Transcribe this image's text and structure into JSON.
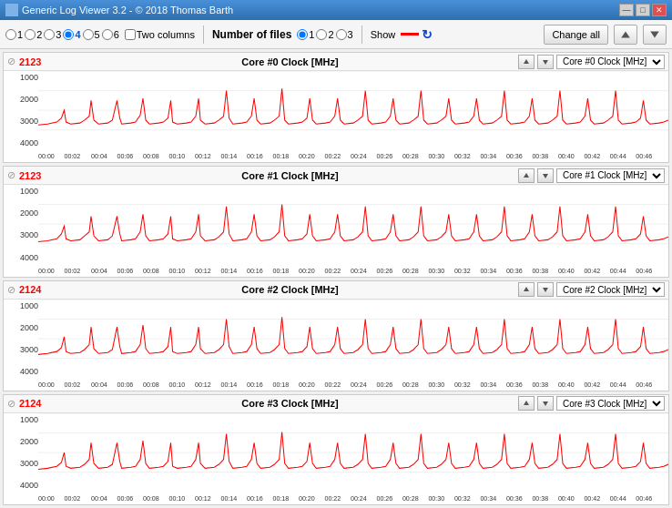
{
  "window": {
    "title": "Generic Log Viewer 3.2 - © 2018 Thomas Barth"
  },
  "toolbar": {
    "radio_labels": [
      "1",
      "2",
      "3",
      "4",
      "5",
      "6"
    ],
    "checked_radio": "4",
    "two_columns_label": "Two columns",
    "two_columns_checked": false,
    "number_of_files_label": "Number of files",
    "file_radios": [
      "1",
      "2",
      "3"
    ],
    "file_checked": "1",
    "show_label": "Show",
    "change_all_label": "Change all"
  },
  "charts": [
    {
      "id": "chart0",
      "phi": "⊘",
      "value": "2123",
      "title": "Core #0 Clock [MHz]",
      "dropdown": "Core #0 Clock [MHz]",
      "y_labels": [
        "4000",
        "3000",
        "2000",
        "1000"
      ],
      "x_labels": [
        "00:00",
        "00:02",
        "00:04",
        "00:06",
        "00:08",
        "00:10",
        "00:12",
        "00:14",
        "00:16",
        "00:18",
        "00:20",
        "00:22",
        "00:24",
        "00:26",
        "00:28",
        "00:30",
        "00:32",
        "00:34",
        "00:36",
        "00:38",
        "00:40",
        "00:42",
        "00:44",
        "00:46"
      ]
    },
    {
      "id": "chart1",
      "phi": "⊘",
      "value": "2123",
      "title": "Core #1 Clock [MHz]",
      "dropdown": "Core #1 Clock [MHz]",
      "y_labels": [
        "4000",
        "3000",
        "2000",
        "1000"
      ],
      "x_labels": [
        "00:00",
        "00:02",
        "00:04",
        "00:06",
        "00:08",
        "00:10",
        "00:12",
        "00:14",
        "00:16",
        "00:18",
        "00:20",
        "00:22",
        "00:24",
        "00:26",
        "00:28",
        "00:30",
        "00:32",
        "00:34",
        "00:36",
        "00:38",
        "00:40",
        "00:42",
        "00:44",
        "00:46"
      ]
    },
    {
      "id": "chart2",
      "phi": "⊘",
      "value": "2124",
      "title": "Core #2 Clock [MHz]",
      "dropdown": "Core #2 Clock [MHz]",
      "y_labels": [
        "4000",
        "3000",
        "2000",
        "1000"
      ],
      "x_labels": [
        "00:00",
        "00:02",
        "00:04",
        "00:06",
        "00:08",
        "00:10",
        "00:12",
        "00:14",
        "00:16",
        "00:18",
        "00:20",
        "00:22",
        "00:24",
        "00:26",
        "00:28",
        "00:30",
        "00:32",
        "00:34",
        "00:36",
        "00:38",
        "00:40",
        "00:42",
        "00:44",
        "00:46"
      ]
    },
    {
      "id": "chart3",
      "phi": "⊘",
      "value": "2124",
      "title": "Core #3 Clock [MHz]",
      "dropdown": "Core #3 Clock [MHz]",
      "y_labels": [
        "4000",
        "3000",
        "2000",
        "1000"
      ],
      "x_labels": [
        "00:00",
        "00:02",
        "00:04",
        "00:06",
        "00:08",
        "00:10",
        "00:12",
        "00:14",
        "00:16",
        "00:18",
        "00:20",
        "00:22",
        "00:24",
        "00:26",
        "00:28",
        "00:30",
        "00:32",
        "00:34",
        "00:36",
        "00:38",
        "00:40",
        "00:42",
        "00:44",
        "00:46"
      ]
    }
  ],
  "title_buttons": {
    "minimize": "—",
    "maximize": "□",
    "close": "✕"
  }
}
